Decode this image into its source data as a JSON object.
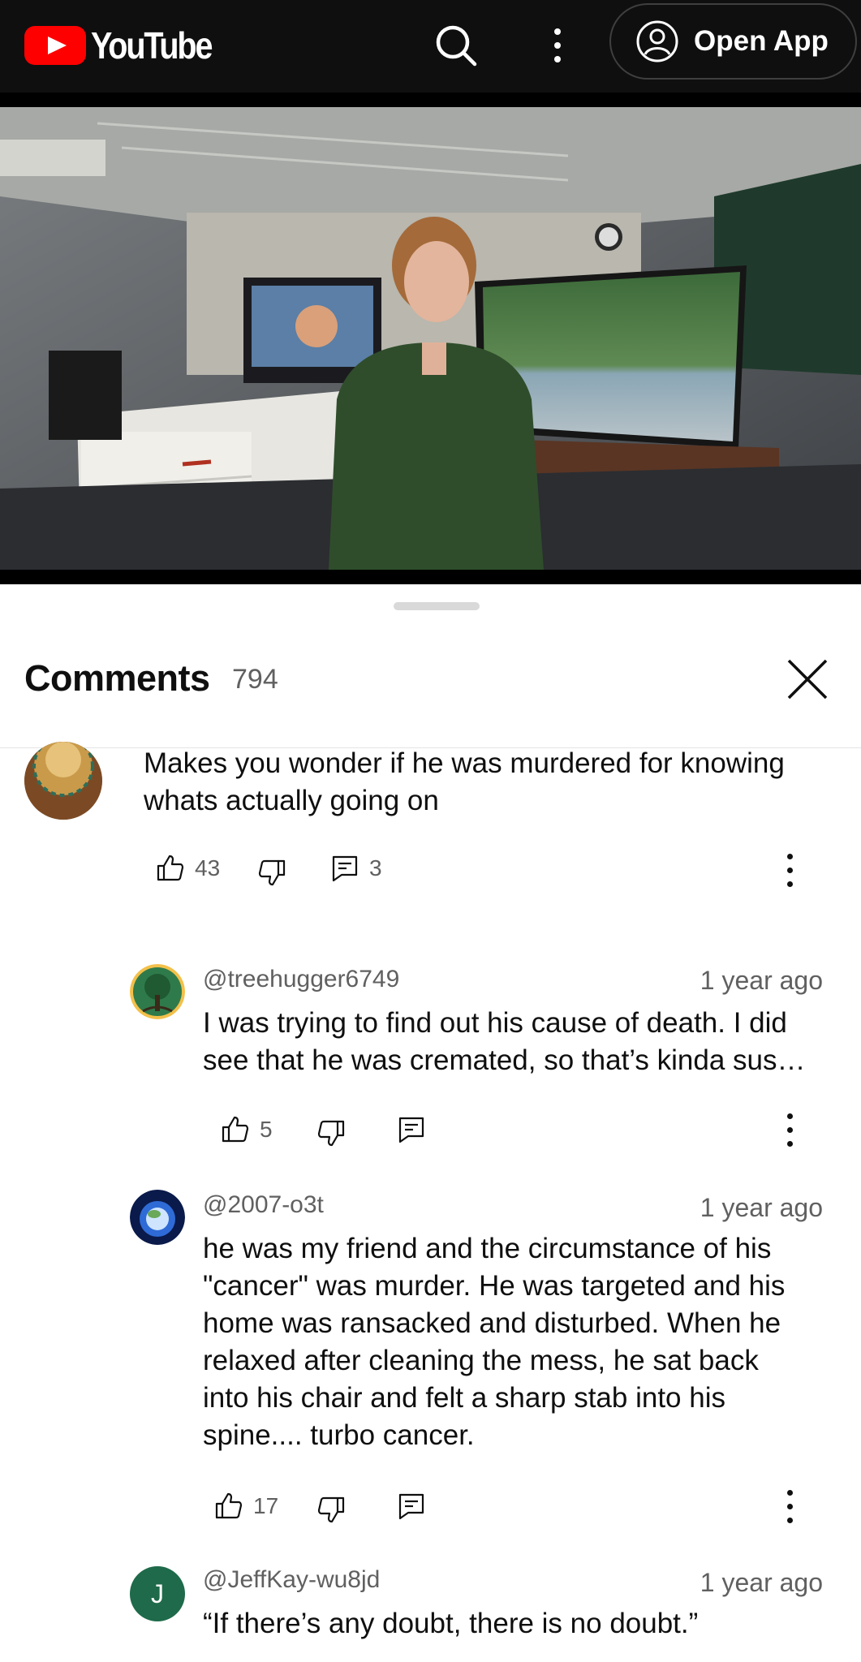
{
  "topbar": {
    "brand": "YouTube",
    "open_app_label": "Open App",
    "icons": [
      "youtube-logo-icon",
      "search-icon",
      "more-vert-icon",
      "account-circle-icon"
    ]
  },
  "sheet": {
    "title": "Comments",
    "count": "794"
  },
  "comments": [
    {
      "text_line1": "Makes you wonder if he was murdered for knowing",
      "text_line2": "whats actually going on",
      "likes": "43",
      "replies": "3"
    },
    {
      "author": "@treehugger6749",
      "time": "1 year ago",
      "text_line1": "I was trying to find out his cause of death. I did",
      "text_line2": "see that he was cremated, so that’s kinda sus…",
      "likes": "5"
    },
    {
      "author": "@2007-o3t",
      "time": "1 year ago",
      "lines": [
        "he was my friend and the circumstance of his",
        "\"cancer\" was murder.  He was targeted and his",
        "home was ransacked and disturbed.  When he",
        "relaxed after cleaning the mess, he sat back",
        "into his chair and felt a sharp stab into his",
        "spine.... turbo cancer."
      ],
      "likes": "17"
    },
    {
      "author": "@JeffKay-wu8jd",
      "time": "1 year ago",
      "avatar_letter": "J",
      "text_line1": "“If there’s any doubt, there is no doubt.”"
    }
  ],
  "colors": {
    "topbar_bg": "#0f0f0f",
    "brand_red": "#ff0000",
    "secondary_text": "#606060",
    "avatar_green": "#1e6a4a"
  }
}
